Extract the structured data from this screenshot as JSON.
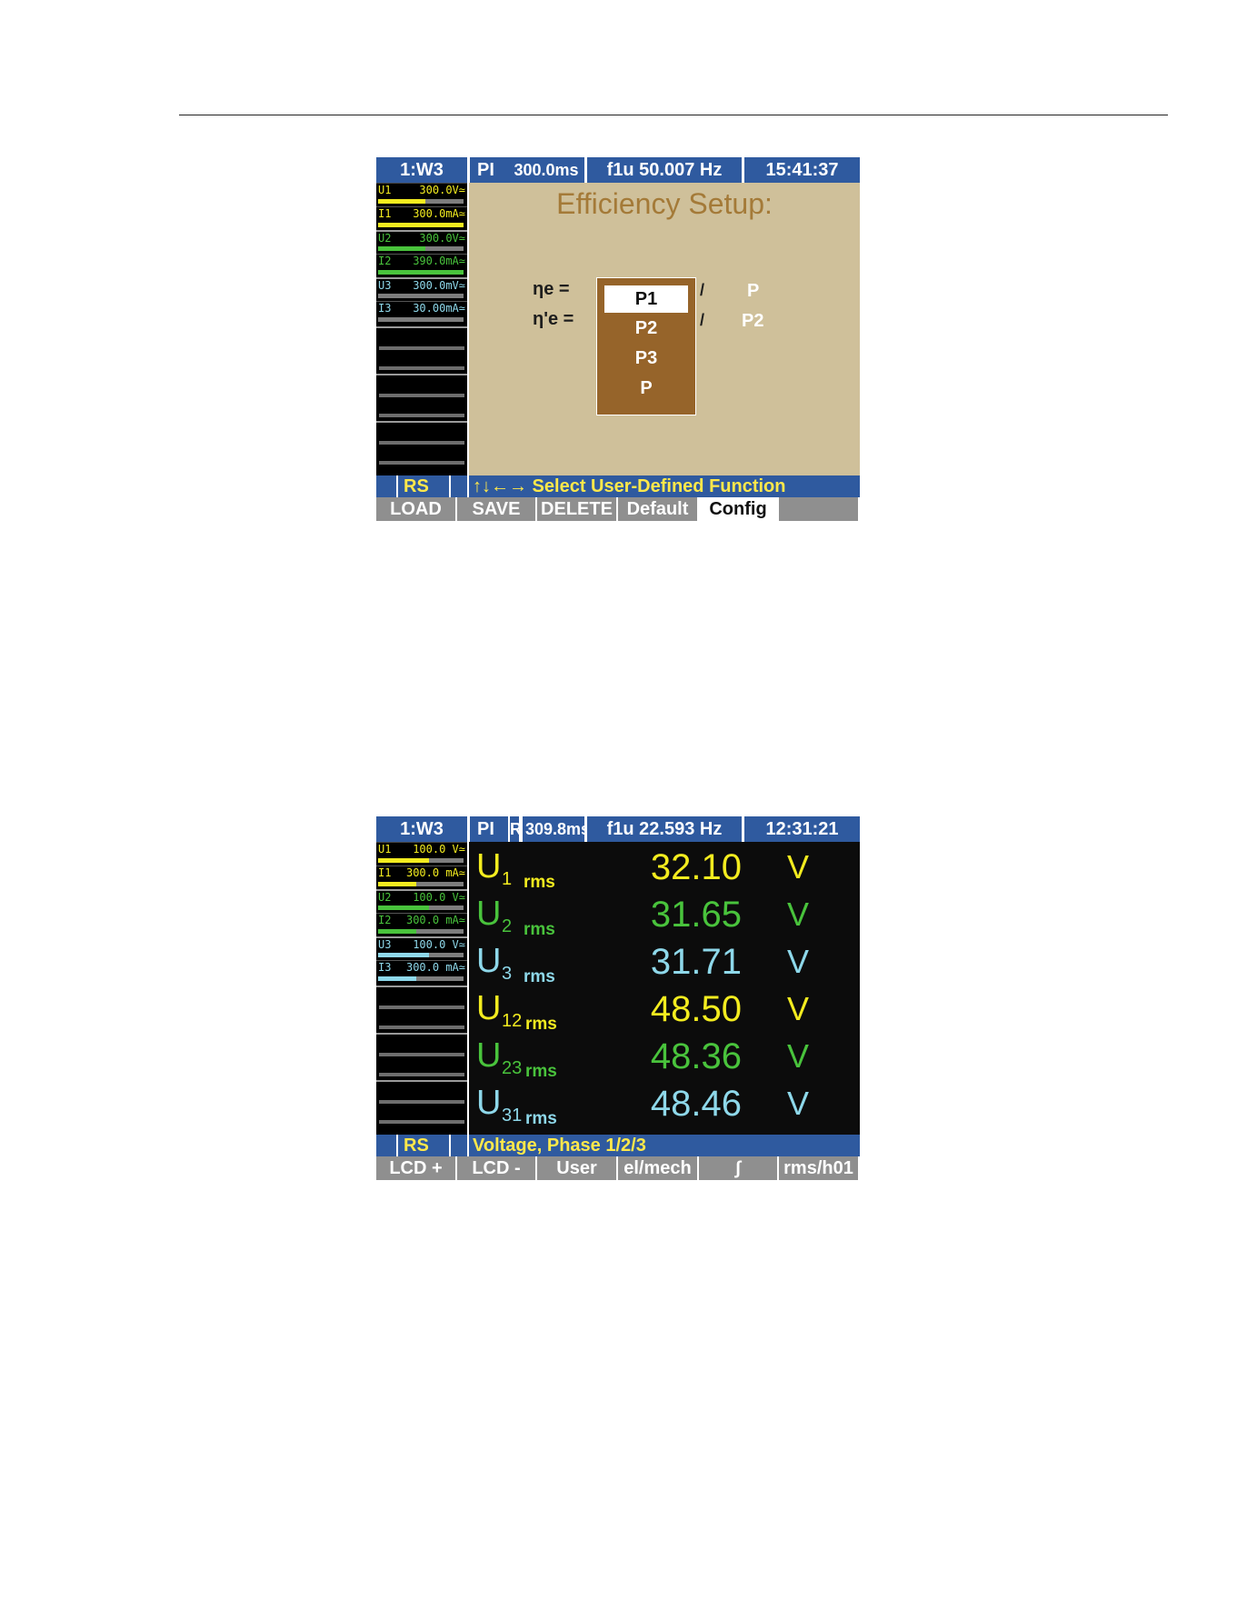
{
  "screen1": {
    "topbar": {
      "mode": "1:W3",
      "pi": "PI",
      "time_interval": "300.0ms",
      "sync": "f1u  50.007 Hz",
      "clock": "15:41:37"
    },
    "channels": [
      {
        "label": "U1",
        "value": "300.0V≃",
        "color": "#f3ec1f",
        "bar_fraction": 0.55
      },
      {
        "label": "I1",
        "value": "300.0mA≃",
        "color": "#f3ec1f",
        "bar_fraction": 1.0
      },
      {
        "label": "U2",
        "value": "300.0V≃",
        "color": "#49c33c",
        "bar_fraction": 0.55
      },
      {
        "label": "I2",
        "value": "390.0mA≃",
        "color": "#49c33c",
        "bar_fraction": 1.0
      },
      {
        "label": "U3",
        "value": "300.0mV≃",
        "color": "#8ed8ea",
        "bar_fraction": 0.0
      },
      {
        "label": "I3",
        "value": "30.00mA≃",
        "color": "#8ed8ea",
        "bar_fraction": 0.0
      }
    ],
    "setup": {
      "title": "Efficiency Setup:",
      "eta_e": "ηe  =",
      "eta_pe": "η'e  =",
      "slash": "/",
      "options": [
        "P1",
        "P2",
        "P3",
        "P"
      ],
      "selected_index": 0,
      "denominator_e": "P",
      "denominator_pe": "P2"
    },
    "statusbar": {
      "range": "RS",
      "message": "↑↓←→ Select User-Defined Function"
    },
    "softkeys": [
      "LOAD",
      "SAVE",
      "DELETE",
      "Default",
      "Config",
      ""
    ],
    "active_softkey_index": 4
  },
  "screen2": {
    "topbar": {
      "mode": "1:W3",
      "pi": "PI",
      "r": "R",
      "time_interval": "309.8ms",
      "sync": "f1u  22.593 Hz",
      "clock": "12:31:21"
    },
    "channels": [
      {
        "label": "U1",
        "value": "100.0 V≃",
        "color": "#f3ec1f",
        "bar_fraction": 0.6
      },
      {
        "label": "I1",
        "value": "300.0 mA≃",
        "color": "#f3ec1f",
        "bar_fraction": 0.45
      },
      {
        "label": "U2",
        "value": "100.0 V≃",
        "color": "#49c33c",
        "bar_fraction": 0.6
      },
      {
        "label": "I2",
        "value": "300.0 mA≃",
        "color": "#49c33c",
        "bar_fraction": 0.45
      },
      {
        "label": "U3",
        "value": "100.0 V≃",
        "color": "#8ed8ea",
        "bar_fraction": 0.6
      },
      {
        "label": "I3",
        "value": "300.0 mA≃",
        "color": "#8ed8ea",
        "bar_fraction": 0.45
      }
    ],
    "measurements": [
      {
        "symbol": "U",
        "subscript": "1",
        "suffix": "rms",
        "value": "32.10",
        "unit": "V",
        "color": "#f3ec1f"
      },
      {
        "symbol": "U",
        "subscript": "2",
        "suffix": "rms",
        "value": "31.65",
        "unit": "V",
        "color": "#49c33c"
      },
      {
        "symbol": "U",
        "subscript": "3",
        "suffix": "rms",
        "value": "31.71",
        "unit": "V",
        "color": "#8ed8ea"
      },
      {
        "symbol": "U",
        "subscript": "12",
        "suffix": "rms",
        "value": "48.50",
        "unit": "V",
        "color": "#f3ec1f"
      },
      {
        "symbol": "U",
        "subscript": "23",
        "suffix": "rms",
        "value": "48.36",
        "unit": "V",
        "color": "#49c33c"
      },
      {
        "symbol": "U",
        "subscript": "31",
        "suffix": "rms",
        "value": "48.46",
        "unit": "V",
        "color": "#8ed8ea"
      }
    ],
    "statusbar": {
      "range": "RS",
      "message": "Voltage, Phase 1/2/3"
    },
    "softkeys": [
      "LCD +",
      "LCD -",
      "User",
      "el/mech",
      "∫",
      "rms/h01"
    ],
    "active_softkey_index": -1
  }
}
